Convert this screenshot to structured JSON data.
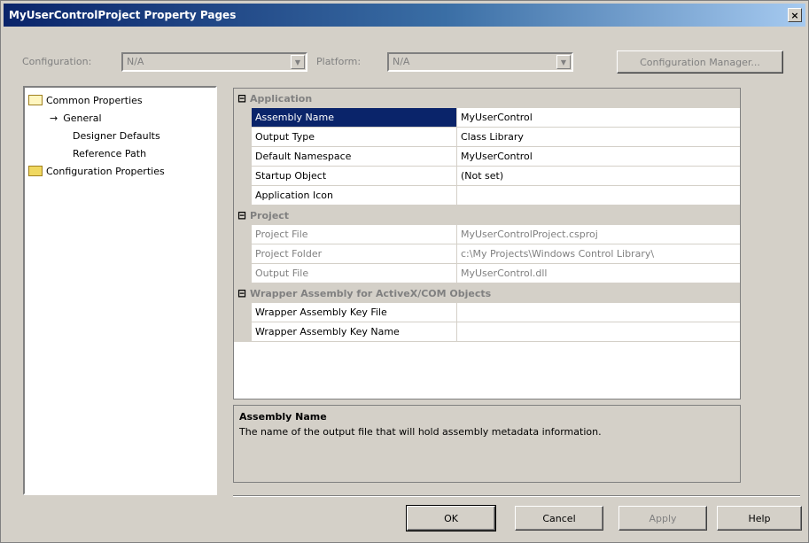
{
  "window": {
    "title": "MyUserControlProject Property Pages",
    "close_label": "×"
  },
  "toolbar": {
    "configuration_label": "Configuration:",
    "configuration_value": "N/A",
    "platform_label": "Platform:",
    "platform_value": "N/A",
    "configuration_manager_label": "Configuration Manager..."
  },
  "tree": {
    "items": [
      {
        "label": "Common Properties",
        "icon": "open-folder-icon"
      },
      {
        "label": "General",
        "icon": "arrow-icon"
      },
      {
        "label": "Designer Defaults"
      },
      {
        "label": "Reference Path"
      },
      {
        "label": "Configuration Properties",
        "icon": "folder-icon"
      }
    ]
  },
  "grid": {
    "categories": [
      {
        "sign": "⊟",
        "label": "Application",
        "rows": [
          {
            "name": "Assembly Name",
            "value": "MyUserControl"
          },
          {
            "name": "Output Type",
            "value": "Class Library"
          },
          {
            "name": "Default Namespace",
            "value": "MyUserControl"
          },
          {
            "name": "Startup Object",
            "value": "(Not set)"
          },
          {
            "name": "Application Icon",
            "value": ""
          }
        ]
      },
      {
        "sign": "⊟",
        "label": "Project",
        "rows": [
          {
            "name": "Project File",
            "value": "MyUserControlProject.csproj"
          },
          {
            "name": "Project Folder",
            "value": "c:\\My Projects\\Windows Control Library\\"
          },
          {
            "name": "Output File",
            "value": "MyUserControl.dll"
          }
        ]
      },
      {
        "sign": "⊟",
        "label": "Wrapper Assembly for ActiveX/COM Objects",
        "rows": [
          {
            "name": "Wrapper Assembly Key File",
            "value": ""
          },
          {
            "name": "Wrapper Assembly Key Name",
            "value": ""
          }
        ]
      }
    ]
  },
  "description": {
    "title": "Assembly Name",
    "text": "The name of the output file that will hold assembly metadata information."
  },
  "buttons": {
    "ok": "OK",
    "cancel": "Cancel",
    "apply": "Apply",
    "help": "Help"
  }
}
